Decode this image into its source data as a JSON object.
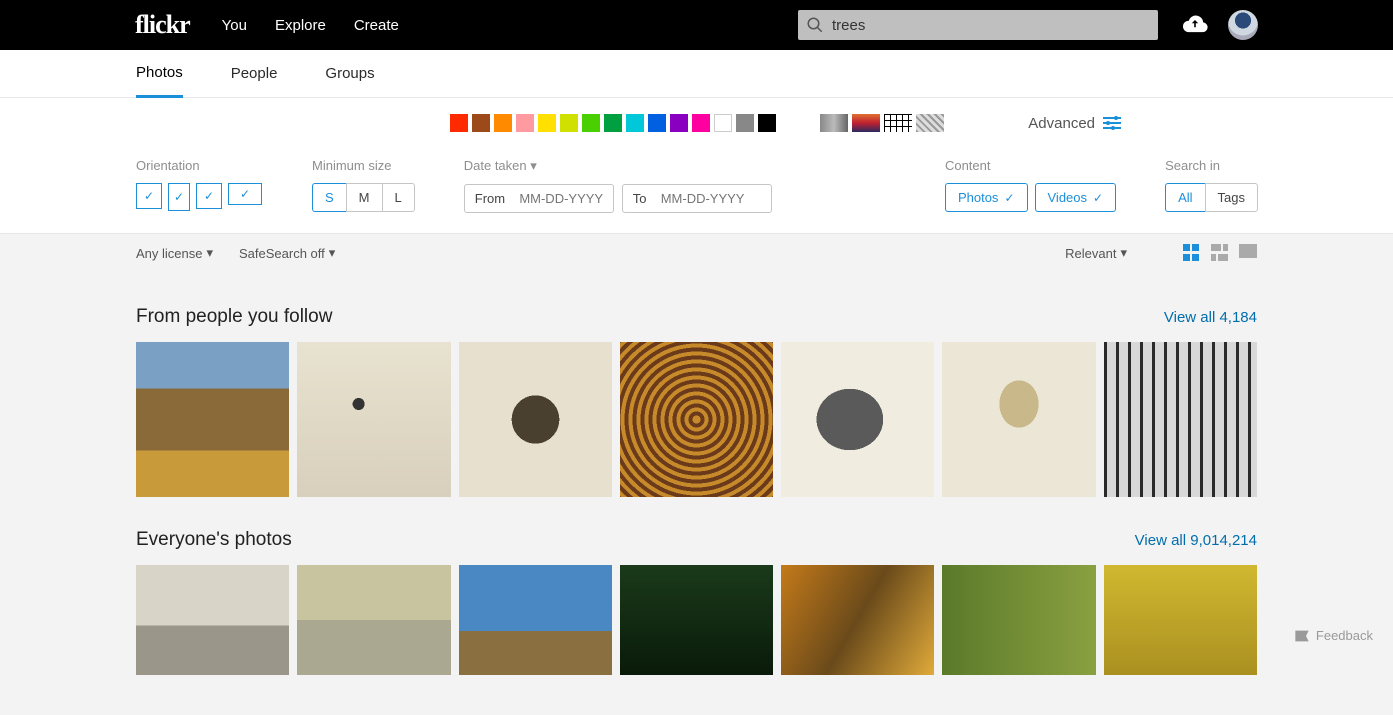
{
  "header": {
    "logo": "flickr",
    "nav": {
      "you": "You",
      "explore": "Explore",
      "create": "Create"
    },
    "search": {
      "value": "trees"
    }
  },
  "tabs": {
    "photos": "Photos",
    "people": "People",
    "groups": "Groups"
  },
  "advanced": "Advanced",
  "colors": [
    "#ff2a00",
    "#9c4a1a",
    "#ff8a00",
    "#ff9aa0",
    "#ffe000",
    "#d0e000",
    "#4ad000",
    "#00a040",
    "#00c8d8",
    "#0060e0",
    "#8a00c0",
    "#ff00a0",
    "#ffffff",
    "#888888",
    "#000000"
  ],
  "filters": {
    "orientation_label": "Orientation",
    "minsize_label": "Minimum size",
    "minsize": {
      "s": "S",
      "m": "M",
      "l": "L"
    },
    "date_label": "Date taken",
    "date_from": "From",
    "date_to": "To",
    "date_placeholder": "MM-DD-YYYY",
    "content_label": "Content",
    "content_photos": "Photos",
    "content_videos": "Videos",
    "searchin_label": "Search in",
    "searchin_all": "All",
    "searchin_tags": "Tags"
  },
  "subfilter": {
    "license": "Any license",
    "safesearch": "SafeSearch off",
    "sort": "Relevant"
  },
  "sections": {
    "follow_title": "From people you follow",
    "follow_link": "View all 4,184",
    "everyone_title": "Everyone's photos",
    "everyone_link": "View all 9,014,214"
  },
  "feedback": "Feedback"
}
